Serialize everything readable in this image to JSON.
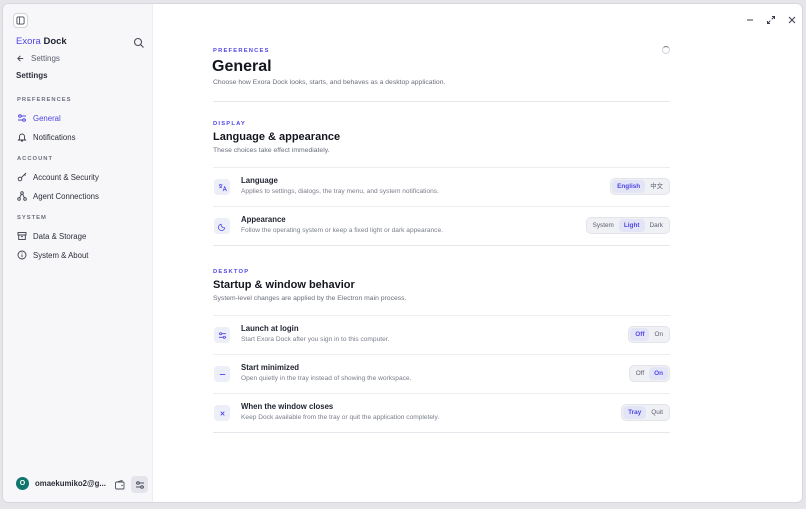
{
  "app": {
    "brand_part1": "Exora",
    "brand_part2": "Dock"
  },
  "sidebar": {
    "back_label": "Settings",
    "title": "Settings",
    "sections": [
      {
        "label": "PREFERENCES",
        "items": [
          {
            "label": "General",
            "icon": "sliders-icon",
            "active": true
          },
          {
            "label": "Notifications",
            "icon": "bell-icon"
          }
        ]
      },
      {
        "label": "ACCOUNT",
        "items": [
          {
            "label": "Account & Security",
            "icon": "key-icon"
          },
          {
            "label": "Agent Connections",
            "icon": "network-icon"
          }
        ]
      },
      {
        "label": "SYSTEM",
        "items": [
          {
            "label": "Data & Storage",
            "icon": "archive-icon"
          },
          {
            "label": "System & About",
            "icon": "info-icon"
          }
        ]
      }
    ],
    "user": {
      "initial": "O",
      "email": "omaekumiko2@g..."
    }
  },
  "main": {
    "eyebrow": "PREFERENCES",
    "title": "General",
    "subtitle": "Choose how Exora Dock looks, starts, and behaves as a desktop application.",
    "display": {
      "eyebrow": "DISPLAY",
      "title": "Language & appearance",
      "subtitle": "These choices take effect immediately.",
      "rows": [
        {
          "title": "Language",
          "desc": "Applies to settings, dialogs, the tray menu, and system notifications.",
          "icon": "translate-icon",
          "options": [
            "English",
            "中文"
          ],
          "selected": "English"
        },
        {
          "title": "Appearance",
          "desc": "Follow the operating system or keep a fixed light or dark appearance.",
          "icon": "moon-icon",
          "options": [
            "System",
            "Light",
            "Dark"
          ],
          "selected": "Light"
        }
      ]
    },
    "desktop": {
      "eyebrow": "DESKTOP",
      "title": "Startup & window behavior",
      "subtitle": "System-level changes are applied by the Electron main process.",
      "rows": [
        {
          "title": "Launch at login",
          "desc": "Start Exora Dock after you sign in to this computer.",
          "icon": "sliders-icon",
          "options": [
            "Off",
            "On"
          ],
          "selected": "Off"
        },
        {
          "title": "Start minimized",
          "desc": "Open quietly in the tray instead of showing the workspace.",
          "icon": "minus-icon",
          "options": [
            "Off",
            "On"
          ],
          "selected": "On"
        },
        {
          "title": "When the window closes",
          "desc": "Keep Dock available from the tray or quit the application completely.",
          "icon": "close-icon",
          "options": [
            "Tray",
            "Quit"
          ],
          "selected": "Tray"
        }
      ]
    }
  },
  "colors": {
    "accent": "#4f46e5",
    "avatar": "#0f766e"
  }
}
